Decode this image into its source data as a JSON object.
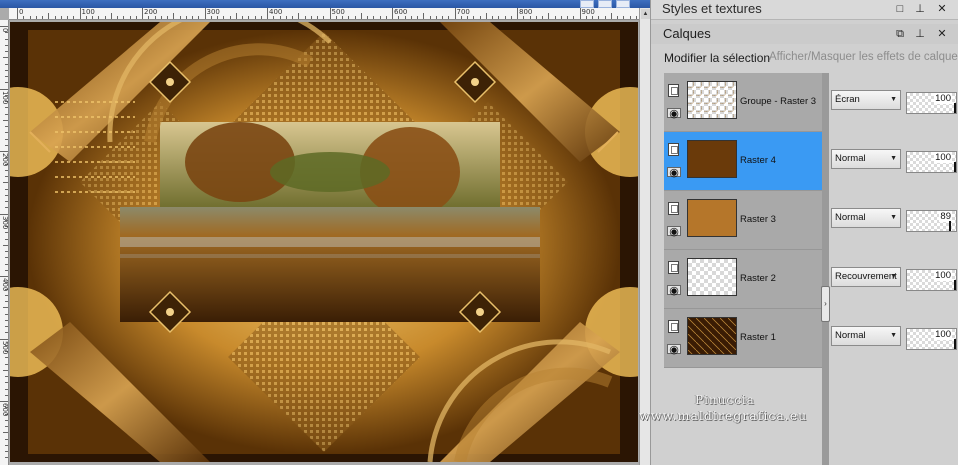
{
  "ruler": {
    "top_labels": [
      "0",
      "100",
      "200",
      "300",
      "400",
      "500",
      "600",
      "700",
      "800",
      "900"
    ],
    "left_labels": [
      "0",
      "100",
      "200",
      "300",
      "400",
      "500",
      "600"
    ]
  },
  "panel": {
    "palette_title": "Styles et textures",
    "layers_title": "Calques",
    "modify_selection": "Modifier la sélection",
    "toggle_effects": "Afficher/Masquer les effets de calque"
  },
  "layers": [
    {
      "name": "Groupe - Raster 3",
      "blend": "Écran",
      "opacity": "100",
      "opacity_fraction": 1.0,
      "selected": false
    },
    {
      "name": "Raster 4",
      "blend": "Normal",
      "opacity": "100",
      "opacity_fraction": 1.0,
      "selected": true
    },
    {
      "name": "Raster 3",
      "blend": "Normal",
      "opacity": "89",
      "opacity_fraction": 0.89,
      "selected": false
    },
    {
      "name": "Raster 2",
      "blend": "Recouvrement",
      "opacity": "100",
      "opacity_fraction": 1.0,
      "selected": false
    },
    {
      "name": "Raster 1",
      "blend": "Normal",
      "opacity": "100",
      "opacity_fraction": 1.0,
      "selected": false
    }
  ],
  "watermark": {
    "line1": "Pinuccia",
    "line2": "www.maldiregrafica.eu"
  },
  "colors": {
    "selection": "#3a9af3",
    "title_bar": "#2f5eab"
  },
  "icons": {
    "eye": "eye-icon",
    "lock": "layer-lock-icon",
    "dropdown": "chevron-down-icon",
    "pin": "pin-icon",
    "close": "close-icon"
  }
}
